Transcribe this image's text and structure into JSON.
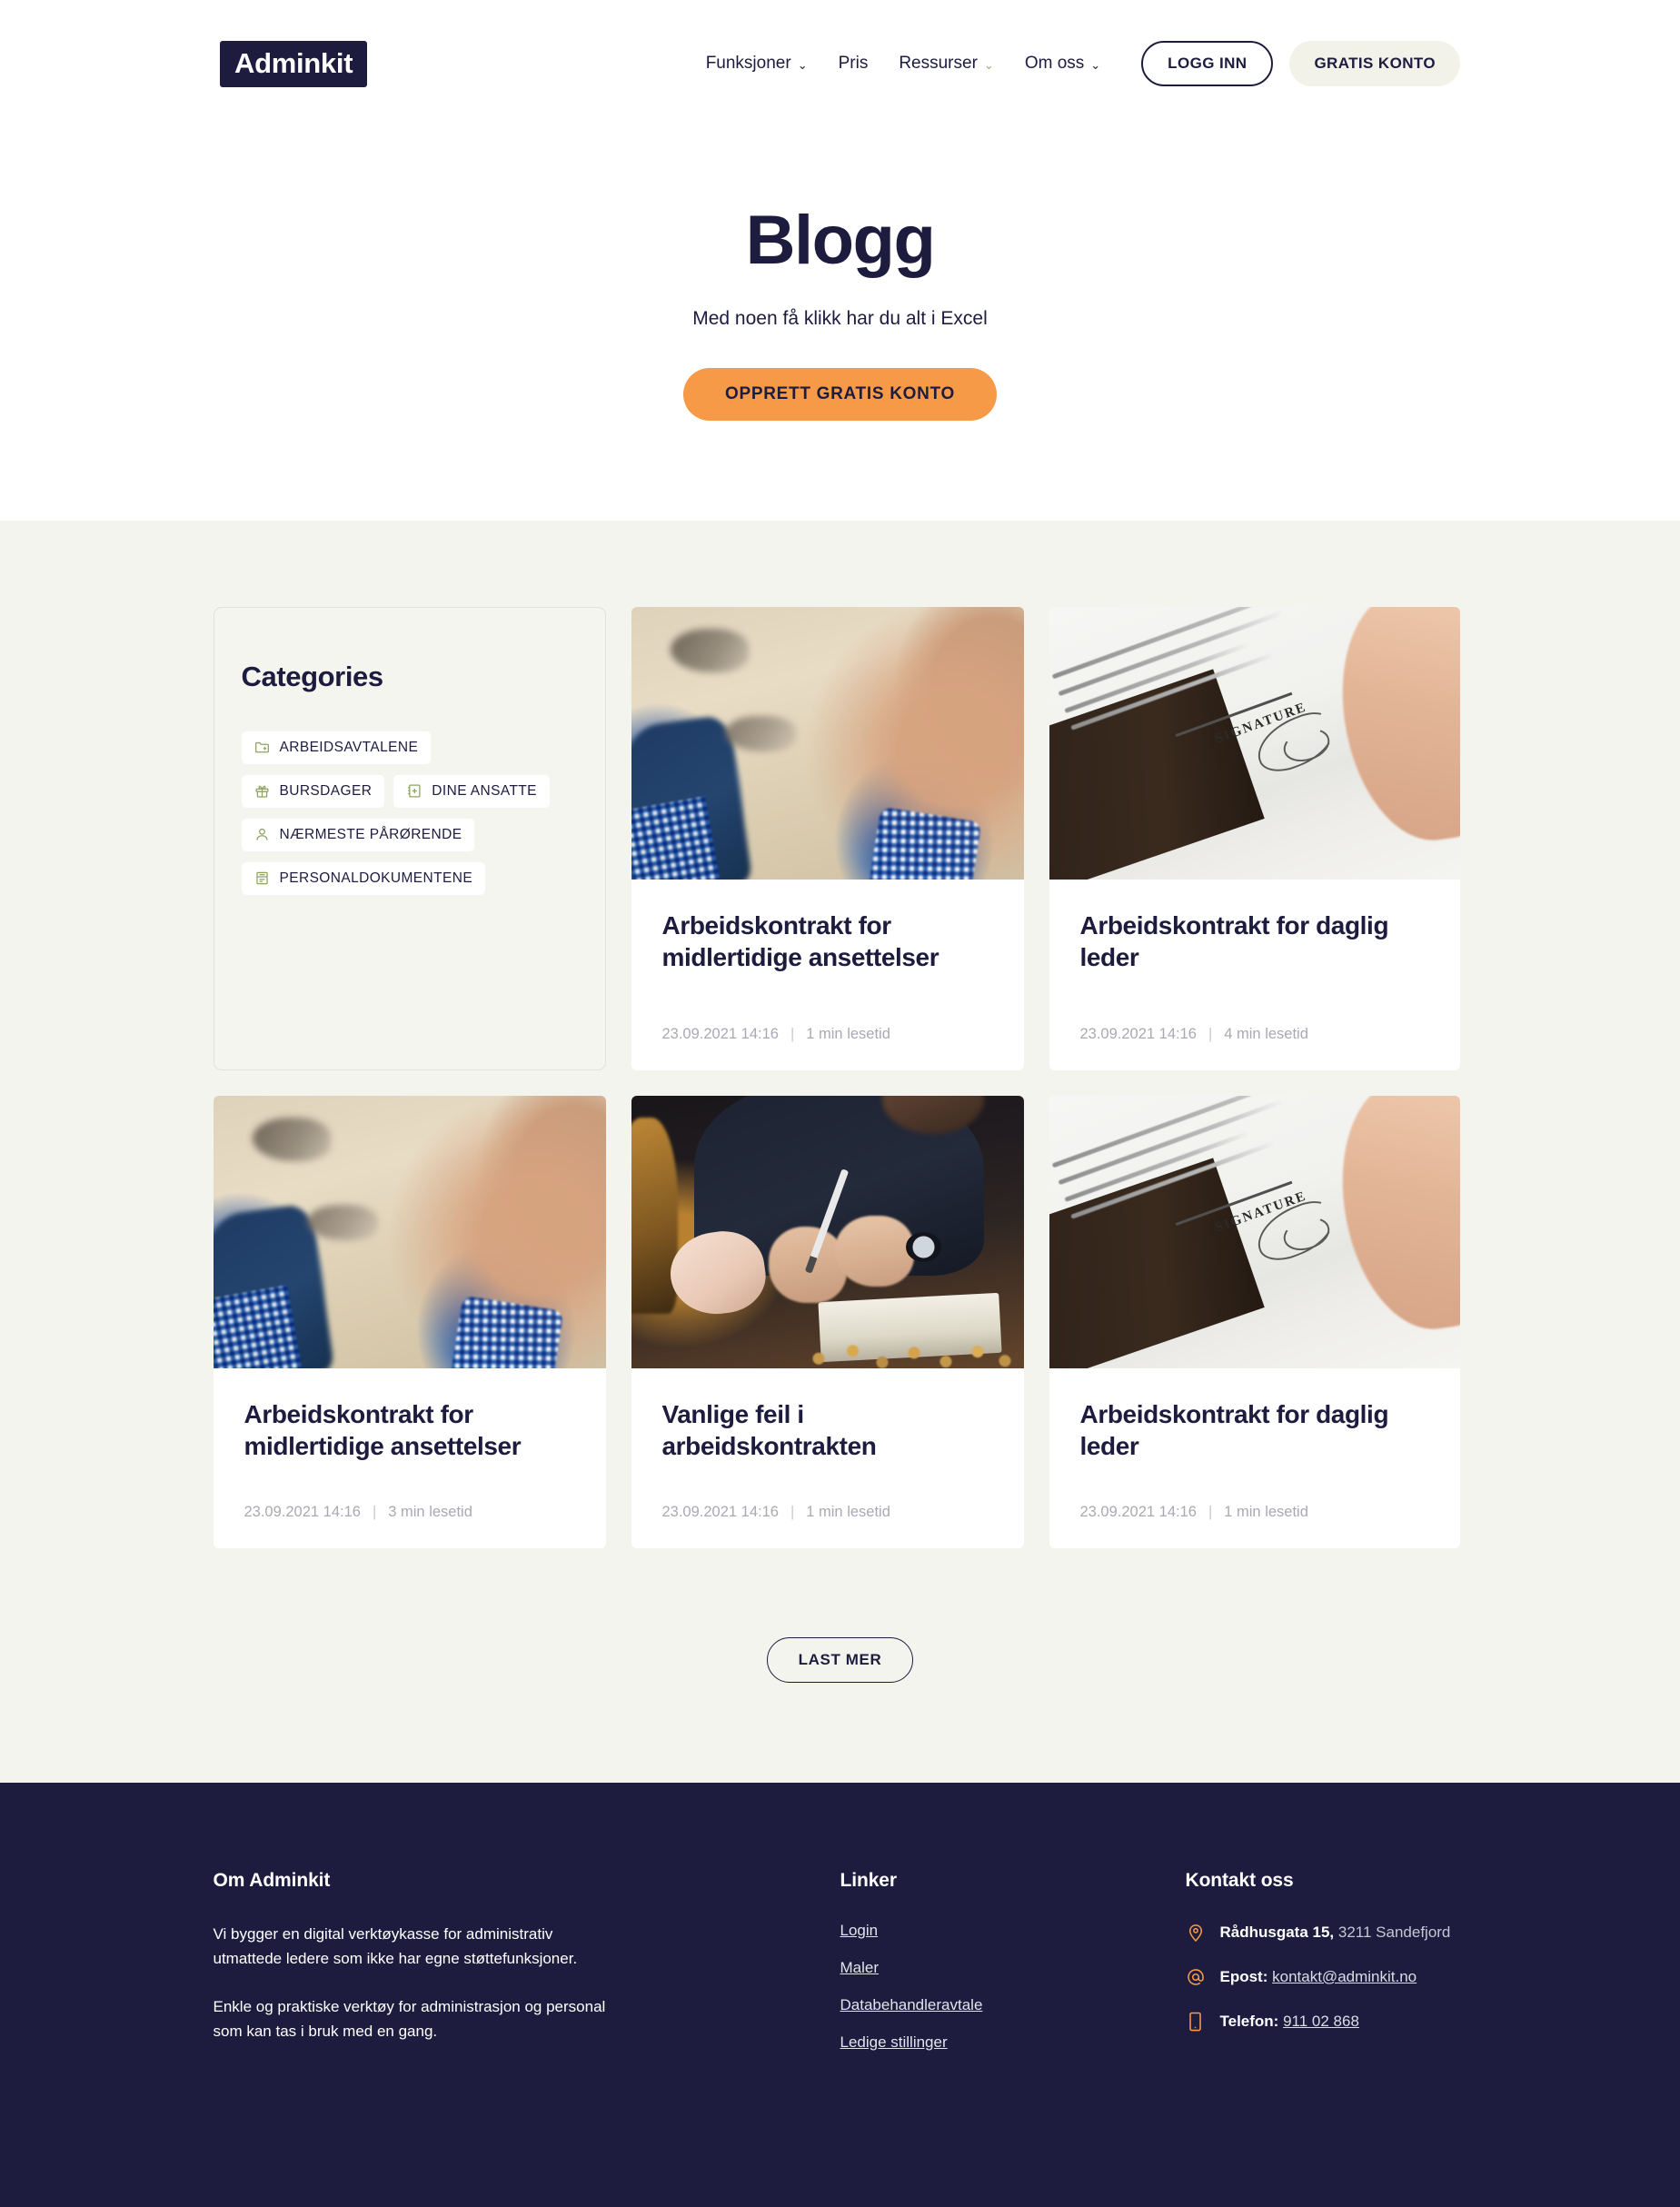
{
  "brand": {
    "logo_text": "Adminkit",
    "logo_bg": "#1d1c3f",
    "logo_dot_color": "#97ab69",
    "accent_orange": "#f79a48",
    "navy": "#1d1c3f",
    "page_bg": "#f4f4ee"
  },
  "nav": {
    "items": [
      {
        "label": "Funksjoner",
        "caret": "⌄",
        "caret_color": "navy"
      },
      {
        "label": "Pris",
        "caret": "",
        "caret_color": "none"
      },
      {
        "label": "Ressurser",
        "caret": "⌄",
        "caret_color": "green"
      },
      {
        "label": "Om oss",
        "caret": "⌄",
        "caret_color": "navy"
      }
    ],
    "login_label": "LOGG INN",
    "free_account_label": "GRATIS KONTO"
  },
  "hero": {
    "title": "Blogg",
    "subtitle": "Med noen få klikk har du alt i Excel",
    "cta_label": "OPPRETT GRATIS KONTO"
  },
  "categories": {
    "title": "Categories",
    "items": [
      {
        "label": "ARBEIDSAVTALENE",
        "icon": "folder-plus-icon"
      },
      {
        "label": "BURSDAGER",
        "icon": "gift-icon"
      },
      {
        "label": "DINE ANSATTE",
        "icon": "notebook-plus-icon"
      },
      {
        "label": "NÆRMESTE PÅRØRENDE",
        "icon": "user-icon"
      },
      {
        "label": "PERSONALDOKUMENTENE",
        "icon": "document-list-icon"
      }
    ]
  },
  "posts": [
    {
      "title": "Arbeidskontrakt for midlertidige ansettelser",
      "date": "23.09.2021 14:16",
      "separator": "|",
      "readtime": "1 min lesetid",
      "image": "handshake"
    },
    {
      "title": "Arbeidskontrakt for daglig leder",
      "date": "23.09.2021 14:16",
      "separator": "|",
      "readtime": "4 min lesetid",
      "image": "contract-signing"
    },
    {
      "title": "Arbeidskontrakt for midlertidige ansettelser",
      "date": "23.09.2021 14:16",
      "separator": "|",
      "readtime": "3 min lesetid",
      "image": "handshake"
    },
    {
      "title": "Vanlige feil i arbeidskontrakten",
      "date": "23.09.2021 14:16",
      "separator": "|",
      "readtime": "1 min lesetid",
      "image": "desk-writing"
    },
    {
      "title": "Arbeidskontrakt for daglig leder",
      "date": "23.09.2021 14:16",
      "separator": "|",
      "readtime": "1 min lesetid",
      "image": "contract-signing"
    }
  ],
  "load_more_label": "LAST MER",
  "footer": {
    "about": {
      "heading": "Om Adminkit",
      "paragraph1": "Vi bygger en digital verktøykasse for administrativ utmattede ledere som ikke har egne støttefunksjoner.",
      "paragraph2": "Enkle og praktiske verktøy for administrasjon og personal som kan tas i bruk med en gang."
    },
    "links": {
      "heading": "Linker",
      "items": [
        {
          "label": "Login"
        },
        {
          "label": "Maler"
        },
        {
          "label": "Databehandleravtale"
        },
        {
          "label": "Ledige stillinger"
        }
      ]
    },
    "contact": {
      "heading": "Kontakt oss",
      "address_strong": "Rådhusgata 15,",
      "address_rest": " 3211 Sandefjord",
      "email_label": "Epost:",
      "email_value": "kontakt@adminkit.no",
      "phone_label": "Telefon:",
      "phone_value": "911 02 868",
      "icon_color": "#f79a48"
    }
  }
}
